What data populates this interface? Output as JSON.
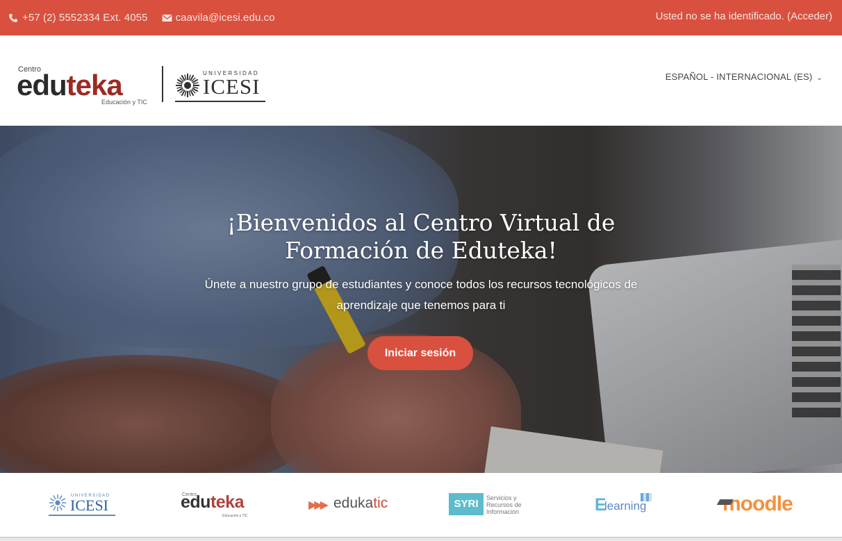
{
  "topbar": {
    "phone_icon": "phone-icon",
    "phone": "+57 (2) 5552334 Ext. 4055",
    "email_icon": "envelope-icon",
    "email": "caavila@icesi.edu.co",
    "login_prefix": "Usted no se ha identificado. (",
    "login_link": "Acceder",
    "login_suffix": ")"
  },
  "header": {
    "logo": {
      "centro": "Centro",
      "edu": "edu",
      "teka": "teka",
      "tagline": "Educación y TIC",
      "universidad": "UNIVERSIDAD",
      "icesi": "ICESI"
    },
    "language": "ESPAÑOL - INTERNACIONAL (ES)"
  },
  "hero": {
    "title_line1": "¡Bienvenidos al Centro Virtual de",
    "title_line2": "Formación de Eduteka!",
    "subtitle": "Únete a nuestro grupo de estudiantes y conoce todos los recursos tecnológicos de aprendizaje que tenemos para ti",
    "button": "Iniciar sesión"
  },
  "partners": {
    "icesi": {
      "universidad": "UNIVERSIDAD",
      "name": "ICESI"
    },
    "eduteka": {
      "centro": "Centro",
      "edu": "edu",
      "teka": "teka",
      "tagline": "Educación y TIC"
    },
    "edukatic": {
      "edu": "eduka",
      "tic": "tic"
    },
    "syri": {
      "box": "SYRI",
      "line1": "Servicios y",
      "line2": "Recursos de",
      "line3": "Información"
    },
    "elearning": {
      "E": "E",
      "word": "learning"
    },
    "moodle": {
      "word": "moodle"
    }
  },
  "colors": {
    "brand_red": "#d9503f",
    "eduteka_red": "#9c2a24"
  }
}
